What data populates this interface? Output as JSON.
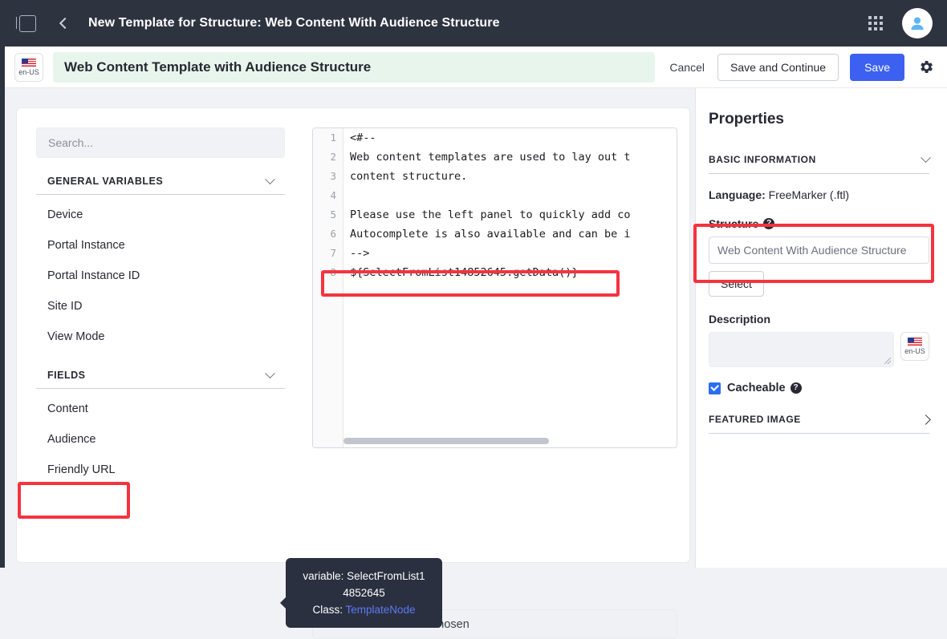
{
  "topbar": {
    "sidebar_toggle": "sidebar-toggle",
    "back": "back",
    "title": "New Template for Structure: Web Content With Audience Structure",
    "apps_grid": "applications-grid",
    "avatar": "user-avatar"
  },
  "toolbar": {
    "locale": "en-US",
    "template_name": "Web Content Template with Audience Structure",
    "cancel_label": "Cancel",
    "save_continue_label": "Save and Continue",
    "save_label": "Save",
    "settings": "gear-icon"
  },
  "sidebar": {
    "search_placeholder": "Search...",
    "groups": [
      {
        "label": "GENERAL VARIABLES",
        "items": [
          "Device",
          "Portal Instance",
          "Portal Instance ID",
          "Site ID",
          "View Mode"
        ]
      },
      {
        "label": "FIELDS",
        "items": [
          "Content",
          "Audience",
          "Friendly URL"
        ]
      }
    ],
    "highlighted_item": "Audience"
  },
  "editor": {
    "line_numbers": [
      "1",
      "2",
      "3",
      "4",
      "5",
      "6",
      "7",
      "8"
    ],
    "lines": [
      "<#--",
      "Web content templates are used to lay out t",
      "content structure.",
      "",
      "Please use the left panel to quickly add co",
      "Autocomplete is also available and can be i",
      "-->",
      "${SelectFromList14852645.getData()}"
    ],
    "highlighted_line": "${SelectFromList14852645.getData()}"
  },
  "tooltip": {
    "variable_label": "variable:",
    "variable_name_line1": "SelectFromList1",
    "variable_name_line2": "4852645",
    "class_label": "Class:",
    "class_value": "TemplateNode"
  },
  "below_field": {
    "text": "chosen"
  },
  "properties": {
    "title": "Properties",
    "basic_information_label": "BASIC INFORMATION",
    "language_label": "Language:",
    "language_value": "FreeMarker (.ftl)",
    "structure_label": "Structure",
    "structure_value": "Web Content With Audience Structure",
    "select_label": "Select",
    "description_label": "Description",
    "description_value": "",
    "description_locale": "en-US",
    "cacheable_label": "Cacheable",
    "cacheable_checked": true,
    "featured_image_label": "FEATURED IMAGE"
  },
  "colors": {
    "header_bg": "#2e3340",
    "primary": "#3c61f0",
    "highlight_red": "#f5333f",
    "title_field_bg": "#e8f5ec",
    "tooltip_bg": "#2b3040",
    "tooltip_link": "#5b79f5"
  }
}
